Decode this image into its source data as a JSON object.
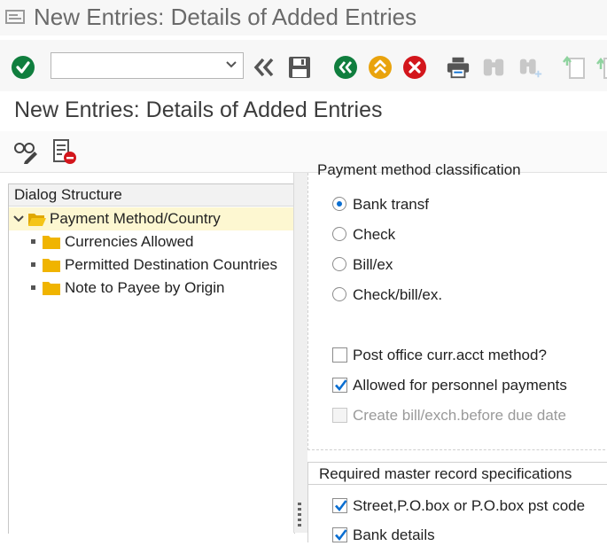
{
  "window": {
    "title": "New Entries: Details of Added Entries"
  },
  "toolbar": {
    "command_value": "",
    "icons": [
      "enter-icon",
      "back-double-icon",
      "save-icon",
      "back-icon",
      "exit-icon",
      "cancel-icon",
      "print-icon",
      "find-icon",
      "find-next-icon",
      "first-page-icon",
      "previous-page-icon"
    ]
  },
  "screen": {
    "title": "New Entries: Details of Added Entries"
  },
  "dialog_structure": {
    "header": "Dialog Structure",
    "root": "Payment Method/Country",
    "children": [
      "Currencies Allowed",
      "Permitted Destination Countries",
      "Note to Payee by Origin"
    ]
  },
  "classification": {
    "group_label": "Payment method classification",
    "radios": [
      {
        "label": "Bank transf",
        "selected": true
      },
      {
        "label": "Check",
        "selected": false
      },
      {
        "label": "Bill/ex",
        "selected": false
      },
      {
        "label": "Check/bill/ex.",
        "selected": false
      }
    ],
    "checkboxes": [
      {
        "label": "Post office curr.acct method?",
        "checked": false,
        "enabled": true
      },
      {
        "label": "Allowed for personnel payments",
        "checked": true,
        "enabled": true
      },
      {
        "label": "Create bill/exch.before due date",
        "checked": false,
        "enabled": false
      }
    ]
  },
  "master_record": {
    "group_label": "Required master record specifications",
    "checkboxes": [
      {
        "label": "Street,P.O.box or P.O.box pst code",
        "checked": true
      },
      {
        "label": "Bank details",
        "checked": true
      }
    ]
  },
  "colors": {
    "accent": "#0a6ed1",
    "green": "#107e3e",
    "orange": "#e9a30d",
    "red": "#d3161c",
    "folder": "#f0b400",
    "selected_row": "#fdf7d1"
  }
}
